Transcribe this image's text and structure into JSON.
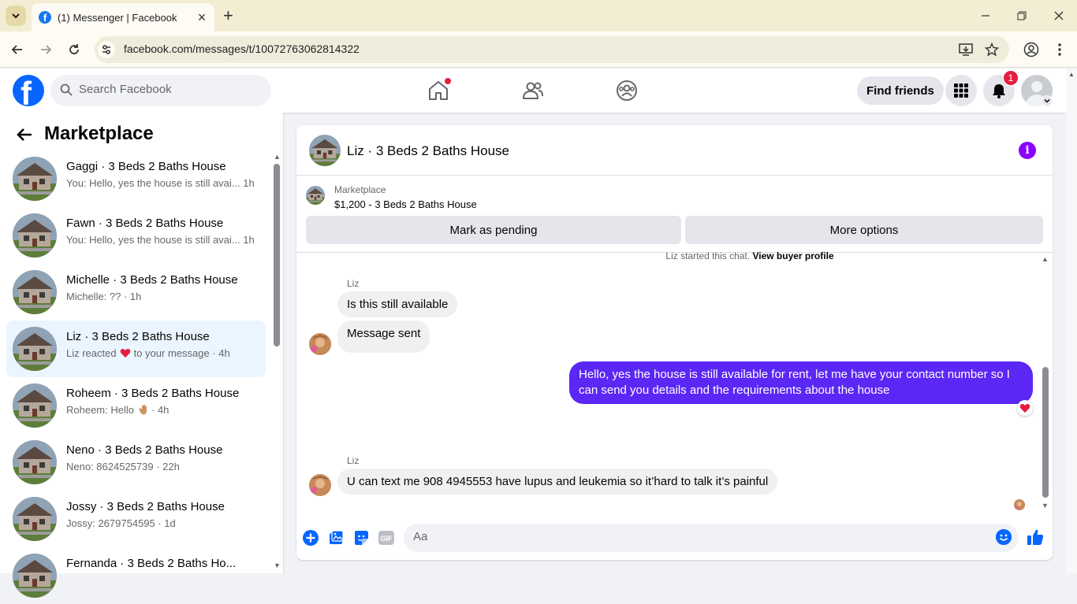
{
  "browser": {
    "tab_title": "(1) Messenger | Facebook",
    "url": "facebook.com/messages/t/10072763062814322"
  },
  "header": {
    "search_placeholder": "Search Facebook",
    "find_friends_label": "Find friends",
    "notification_count": "1"
  },
  "sidebar": {
    "title": "Marketplace",
    "chats": [
      {
        "name": "Gaggi · 3 Beds 2 Baths House",
        "preview": "You: Hello, yes the house is still avai... 1h",
        "active": false
      },
      {
        "name": "Fawn · 3 Beds 2 Baths House",
        "preview": "You: Hello, yes the house is still avai... 1h",
        "active": false
      },
      {
        "name": "Michelle · 3 Beds 2 Baths House",
        "preview": "Michelle: ?? · 1h",
        "active": false
      },
      {
        "name": "Liz · 3 Beds 2 Baths House",
        "preview_prefix": "Liz reacted",
        "preview_suffix": "to your message · 4h",
        "active": true
      },
      {
        "name": "Roheem · 3 Beds 2 Baths House",
        "preview_prefix": "Roheem: Hello",
        "preview_suffix": "· 4h",
        "active": false
      },
      {
        "name": "Neno · 3 Beds 2 Baths House",
        "preview": "Neno: 8624525739 · 22h",
        "active": false
      },
      {
        "name": "Jossy · 3 Beds 2 Baths House",
        "preview": "Jossy: 2679754595 · 1d",
        "active": false
      },
      {
        "name": "Fernanda · 3 Beds 2 Baths Ho...",
        "preview": "",
        "active": false
      }
    ]
  },
  "conversation": {
    "title": "Liz · 3 Beds 2 Baths House",
    "listing_label": "Marketplace",
    "listing_price": "$1,200 - 3 Beds 2 Baths House",
    "mark_pending_label": "Mark as pending",
    "more_options_label": "More options",
    "started_text": "Liz started this chat.",
    "view_buyer_label": "View buyer profile",
    "messages": [
      {
        "sender": "Liz",
        "text": "Is this still available"
      },
      {
        "text": "Message sent"
      },
      {
        "text": "Hello, yes the house is still available for rent, let me have your contact number so I can send you details and the requirements about the house"
      },
      {
        "sender": "Liz",
        "text": "U can text me 908 4945553 have lupus and leukemia so it’hard  to talk it’s painful"
      }
    ],
    "composer_placeholder": "Aa"
  },
  "colors": {
    "accent": "#0866ff",
    "outgoing_bubble": "#5b27f5",
    "active_chat": "#ebf5ff",
    "badge": "#e41e3f"
  }
}
